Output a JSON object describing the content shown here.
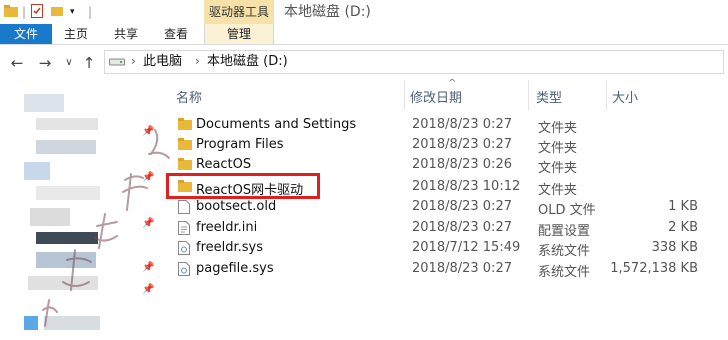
{
  "titlebar": {
    "context_tab": "驱动器工具",
    "window_title": "本地磁盘 (D:)"
  },
  "ribbon": {
    "tabs": [
      "文件",
      "主页",
      "共享",
      "查看",
      "管理"
    ]
  },
  "address": {
    "crumbs": [
      "此电脑",
      "本地磁盘 (D:)"
    ]
  },
  "columns": {
    "name": "名称",
    "date": "修改日期",
    "type": "类型",
    "size": "大小"
  },
  "files": [
    {
      "name": "Documents and Settings",
      "date": "2018/8/23 0:27",
      "type": "文件夹",
      "size": "",
      "icon": "folder-icon"
    },
    {
      "name": "Program Files",
      "date": "2018/8/23 0:27",
      "type": "文件夹",
      "size": "",
      "icon": "folder-icon"
    },
    {
      "name": "ReactOS",
      "date": "2018/8/23 0:26",
      "type": "文件夹",
      "size": "",
      "icon": "folder-icon"
    },
    {
      "name": "ReactOS网卡驱动",
      "date": "2018/8/23 10:12",
      "type": "文件夹",
      "size": "",
      "icon": "folder-icon"
    },
    {
      "name": "bootsect.old",
      "date": "2018/8/23 0:27",
      "type": "OLD 文件",
      "size": "1 KB",
      "icon": "file-icon"
    },
    {
      "name": "freeldr.ini",
      "date": "2018/8/23 0:27",
      "type": "配置设置",
      "size": "2 KB",
      "icon": "ini-file-icon"
    },
    {
      "name": "freeldr.sys",
      "date": "2018/7/12 15:49",
      "type": "系统文件",
      "size": "338 KB",
      "icon": "sys-file-icon"
    },
    {
      "name": "pagefile.sys",
      "date": "2018/8/23 0:27",
      "type": "系统文件",
      "size": "1,572,138 KB",
      "icon": "sys-file-icon"
    }
  ],
  "colors": {
    "file_tab": "#1979ca",
    "context_tab": "#f6e2a8",
    "folder": "#e8b93a",
    "highlight_box": "#e0201f"
  }
}
